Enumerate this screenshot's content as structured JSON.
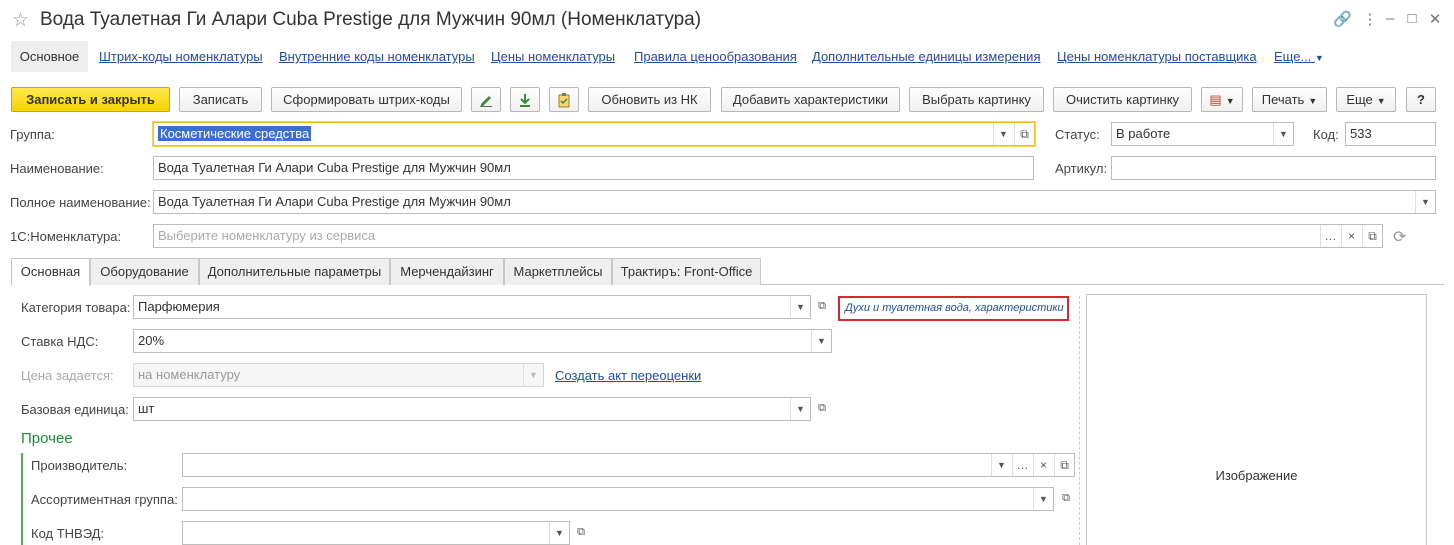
{
  "window": {
    "title": "Вода Туалетная Ги Алари Cuba Prestige для Мужчин 90мл (Номенклатура)",
    "icons": [
      "star-icon",
      "link-icon",
      "more-icon",
      "minimize-icon",
      "maximize-icon",
      "close-icon"
    ]
  },
  "nav_tabs": [
    "Основное",
    "Штрих-коды номенклатуры",
    "Внутренние коды номенклатуры",
    "Цены номенклатуры",
    "Правила ценообразования",
    "Дополнительные единицы измерения",
    "Цены номенклатуры поставщика",
    "Еще..."
  ],
  "toolbar": {
    "save_close": "Записать и закрыть",
    "save": "Записать",
    "gen_barcodes": "Сформировать штрих-коды",
    "update_nk": "Обновить из НК",
    "add_characteristics": "Добавить характеристики",
    "choose_picture": "Выбрать картинку",
    "clear_picture": "Очистить картинку",
    "print": "Печать",
    "more": "Еще",
    "help": "?"
  },
  "header_fields": {
    "group_label": "Группа:",
    "group_value": "Косметические средства",
    "status_label": "Статус:",
    "status_value": "В работе",
    "code_label": "Код:",
    "code_value": "533",
    "name_label": "Наименование:",
    "name_value": "Вода Туалетная Ги Алари Cuba Prestige для Мужчин 90мл",
    "article_label": "Артикул:",
    "article_value": "",
    "fullname_label": "Полное наименование:",
    "fullname_value": "Вода Туалетная Ги Алари Cuba Prestige для Мужчин 90мл",
    "nk_label": "1С:Номенклатура:",
    "nk_placeholder": "Выберите номенклатуру из сервиса"
  },
  "form_tabs": [
    "Основная",
    "Оборудование",
    "Дополнительные параметры",
    "Мерчендайзинг",
    "Маркетплейсы",
    "Трактиръ: Front-Office"
  ],
  "main": {
    "category_label": "Категория товара:",
    "category_value": "Парфюмерия",
    "category_hint": "Духи и туалетная вода, характеристики не и",
    "vat_label": "Ставка НДС:",
    "vat_value": "20%",
    "price_label": "Цена задается:",
    "price_value": "на номенклатуру",
    "revaluation_link": "Создать акт переоценки",
    "unit_label": "Базовая единица:",
    "unit_value": "шт",
    "section_other": "Прочее",
    "manufacturer_label": "Производитель:",
    "manufacturer_value": "",
    "assortment_label": "Ассортиментная группа:",
    "assortment_value": "",
    "tnved_label": "Код ТНВЭД:",
    "tnved_value": "",
    "image_label": "Изображение"
  },
  "colors": {
    "primary_button": "#f7d500",
    "link": "#1c4fa0",
    "section_green": "#1a8c3a",
    "hint_border": "#d9272e",
    "focus_border": "#f0c21a"
  }
}
